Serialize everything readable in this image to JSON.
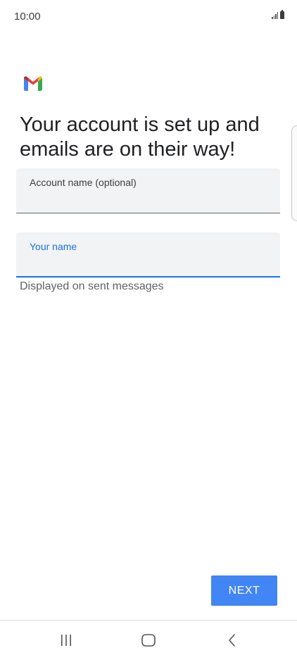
{
  "status_bar": {
    "time": "10:00"
  },
  "icons": {
    "app_logo": "gmail-logo",
    "signal": "signal-icon",
    "battery": "battery-icon",
    "nav_recents": "recents-icon",
    "nav_home": "home-icon",
    "nav_back": "back-icon"
  },
  "setup": {
    "title": "Your account is set up and emails are on their way!",
    "account_name_field": {
      "label": "Account name (optional)",
      "value": ""
    },
    "your_name_field": {
      "label": "Your name",
      "value": "",
      "helper": "Displayed on sent messages"
    },
    "next_label": "NEXT"
  },
  "colors": {
    "accent": "#1a73e8",
    "button": "#4285f4",
    "field_background": "#f1f3f4"
  }
}
